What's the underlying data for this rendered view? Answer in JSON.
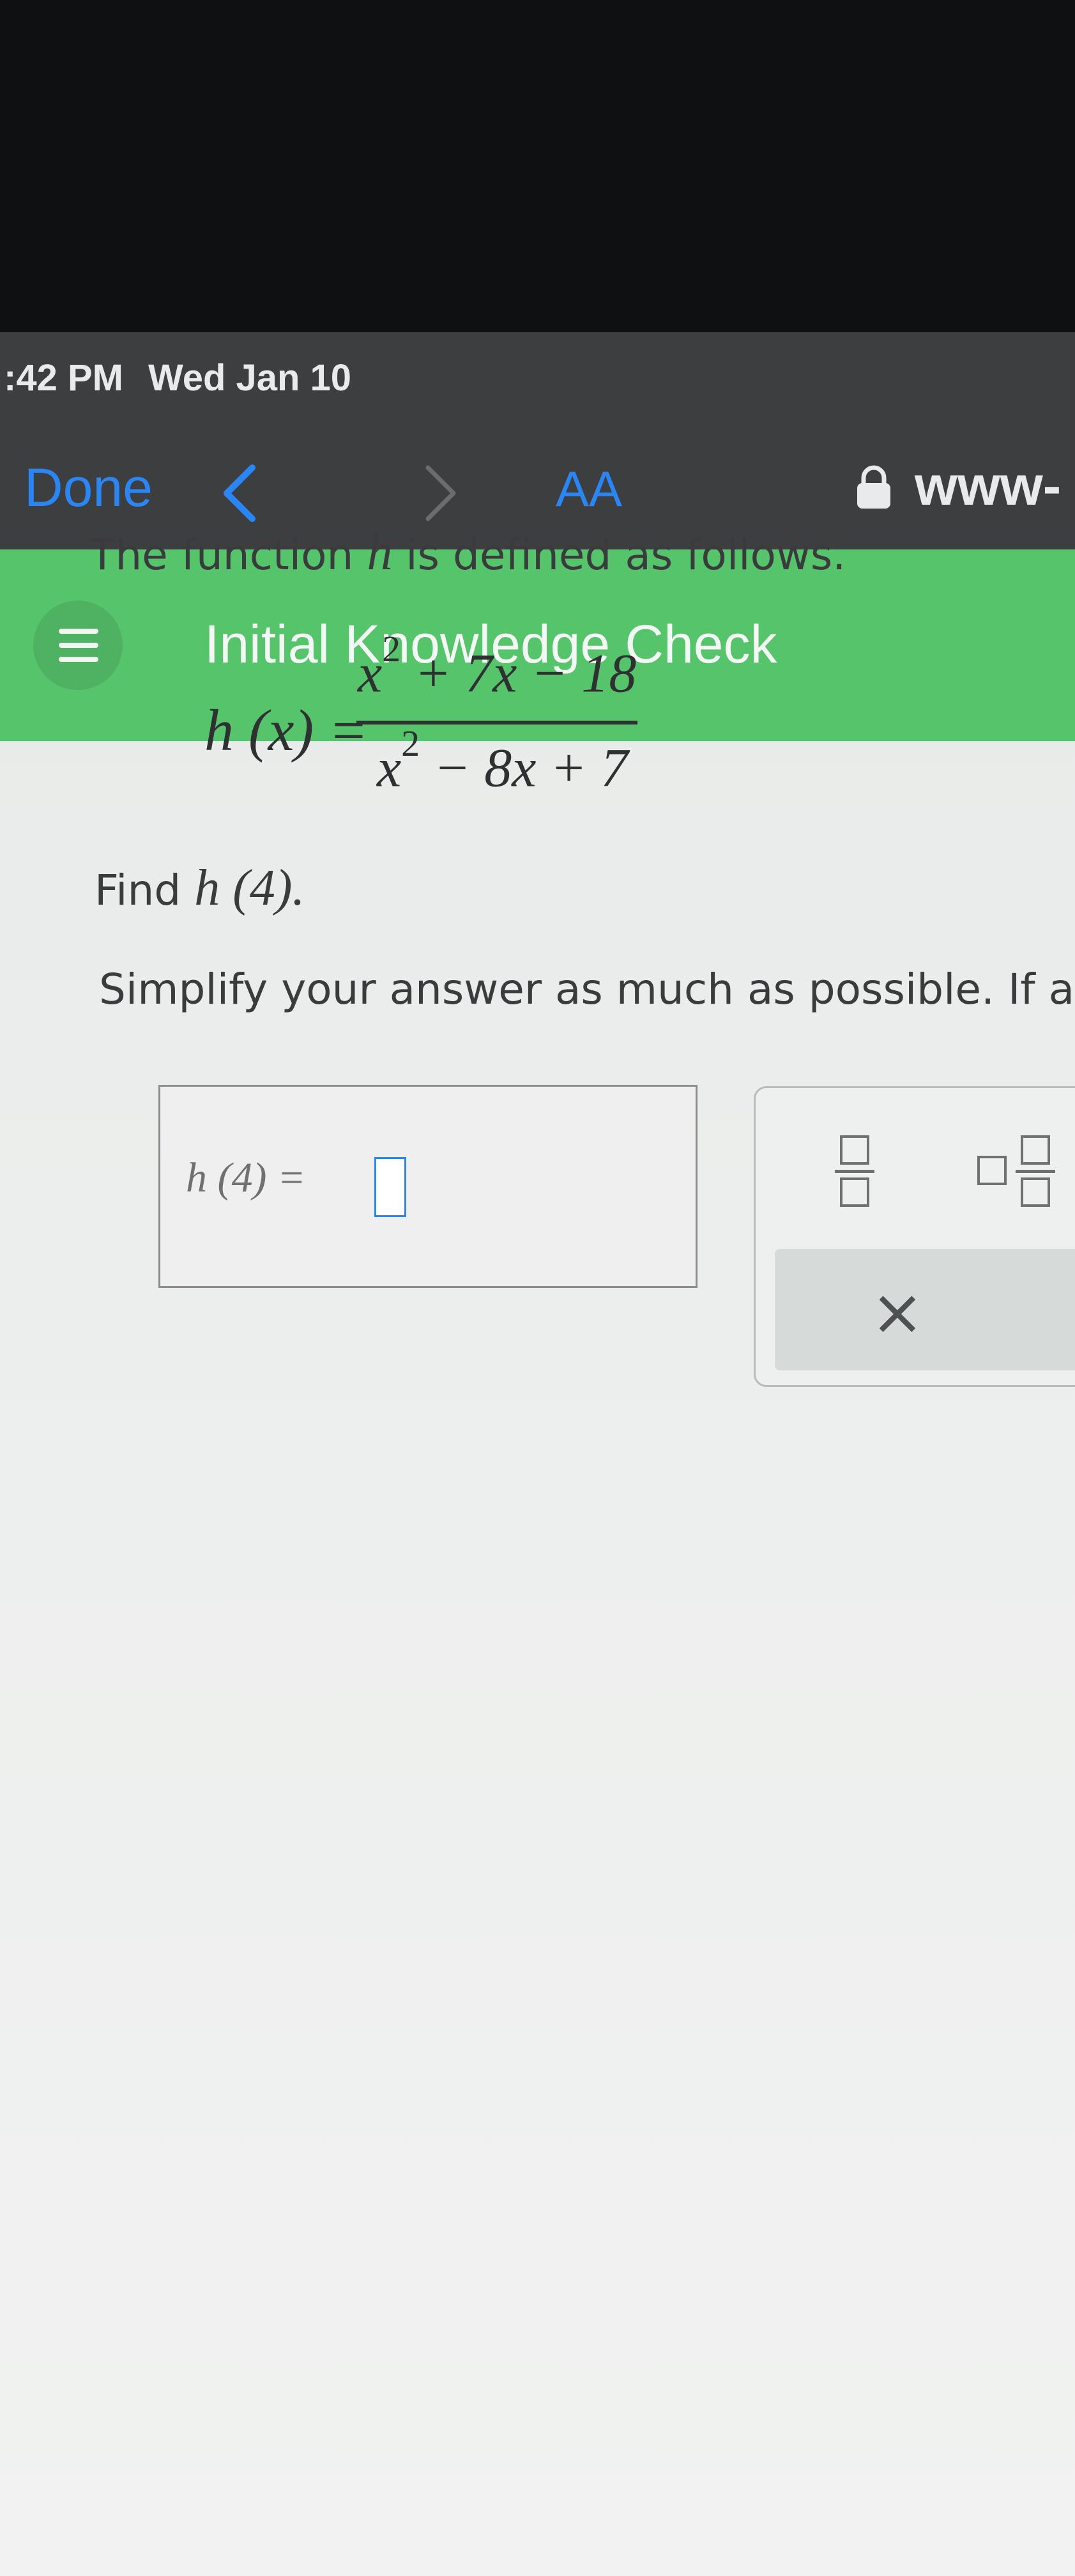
{
  "status_bar": {
    "time": ":42 PM",
    "date": "Wed Jan 10"
  },
  "browser": {
    "done_label": "Done",
    "text_size_label": "AA",
    "url": "www-"
  },
  "header": {
    "title": "Initial Knowledge Check"
  },
  "question": {
    "intro_pre": "The function ",
    "intro_var": "h",
    "intro_post": " is defined as follows.",
    "formula_lhs": "h (x) =",
    "numerator": {
      "base": "x",
      "exp": "2",
      "rest": " + 7x − 18"
    },
    "denominator": {
      "base": "x",
      "exp": "2",
      "rest": " − 8x + 7"
    },
    "find_label": "Find ",
    "find_expr": "h (4).",
    "instruction": "Simplify your answer as much as possible. If ap"
  },
  "answer": {
    "label": "h (4)  =",
    "value": ""
  },
  "keypad": {
    "clear_symbol": "×"
  },
  "colors": {
    "accent": "#2b86f5",
    "header_green": "#55c46b"
  },
  "icons": [
    "chevron-left-icon",
    "chevron-right-icon",
    "lock-icon",
    "menu-icon",
    "fraction-icon",
    "mixed-number-icon",
    "clear-icon"
  ]
}
